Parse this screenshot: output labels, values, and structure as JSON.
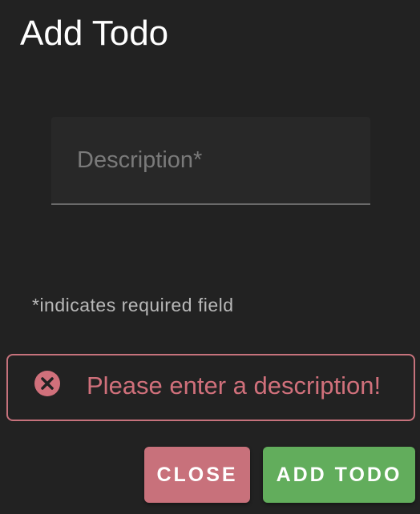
{
  "dialog": {
    "title": "Add Todo",
    "description_field": {
      "placeholder": "Description*",
      "value": ""
    },
    "required_hint": "*indicates required field",
    "error": {
      "icon": "error-circle-x-icon",
      "message": "Please enter a description!"
    },
    "buttons": {
      "close_label": "CLOSE",
      "add_label": "ADD TODO"
    }
  },
  "colors": {
    "background": "#222222",
    "error": "#c8717b",
    "primary": "#62ad5c"
  }
}
